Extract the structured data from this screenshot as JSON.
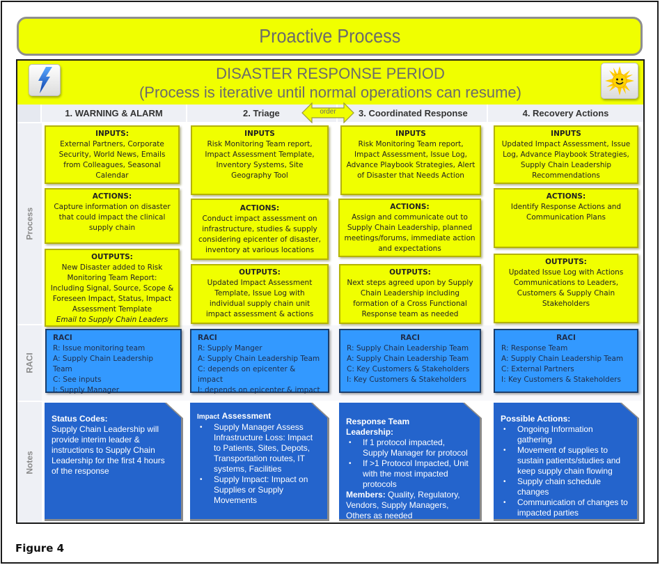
{
  "banner": {
    "title": "Proactive Process"
  },
  "diagram": {
    "title": "DISASTER RESPONSE PERIOD",
    "subtitle": "(Process is iterative until normal operations can resume)",
    "icons": {
      "left": "lightning-bolt-icon",
      "right": "smiling-sun-icon"
    },
    "order_arrow_label": "order",
    "row_labels": {
      "process": "Process",
      "raci": "RACI",
      "notes": "Notes"
    },
    "columns": [
      {
        "header": "1. WARNING & ALARM",
        "inputs": {
          "heading": "INPUTS:",
          "text": "External Partners, Corporate Security, World News, Emails from Colleagues, Seasonal Calendar"
        },
        "actions": {
          "heading": "ACTIONS:",
          "text": "Capture information on disaster that could impact the clinical supply chain"
        },
        "outputs": {
          "heading": "OUTPUTS:",
          "text": "New Disaster added to Risk Monitoring Team Report: Including Signal, Source, Scope & Foreseen Impact, Status, Impact Assessment Template",
          "italic": "Email to Supply Chain Leaders"
        },
        "raci": {
          "heading": "RACI",
          "r": "R: Issue monitoring team",
          "a": "A: Supply Chain Leadership Team",
          "c": "C: See inputs",
          "i": "I: Supply Manager"
        },
        "notes": {
          "heading": "Status Codes:",
          "text": "Supply Chain Leadership will provide interim leader & instructions to Supply Chain Leadership for the first 4 hours of the response"
        }
      },
      {
        "header": "2. Triage",
        "inputs": {
          "heading": "INPUTS",
          "text": "Risk Monitoring Team report, Impact Assessment Template, Inventory Systems, Site Geography Tool"
        },
        "actions": {
          "heading": "ACTIONS:",
          "text": "Conduct impact assessment on infrastructure, studies & supply considering epicenter of disaster, inventory at various locations"
        },
        "outputs": {
          "heading": "OUTPUTS:",
          "text": "Updated Impact Assessment Template, Issue Log with individual supply chain unit impact assessment & actions"
        },
        "raci": {
          "heading": "RACI",
          "r": "R: Supply Manger",
          "a": "A: Supply Chain Leadership Team",
          "c": "C: depends on epicenter & impact",
          "i": "I: depends on epicenter & impact"
        },
        "notes": {
          "heading_small": "Impact",
          "heading": "Assessment",
          "bullets": [
            "Supply Manager Assess Infrastructure Loss: Impact to Patients, Sites, Depots, Transportation routes, IT systems, Facilities",
            "Supply Impact: Impact on Supplies or Supply Movements"
          ]
        }
      },
      {
        "header": "3. Coordinated Response",
        "inputs": {
          "heading": "INPUTS",
          "text": "Risk Monitoring Team report, Impact Assessment, Issue Log, Advance Playbook Strategies, Alert of Disaster that Needs Action"
        },
        "actions": {
          "heading": "ACTIONS:",
          "text": "Assign and communicate out to Supply Chain Leadership, planned meetings/forums, immediate action and expectations"
        },
        "outputs": {
          "heading": "OUTPUTS:",
          "text": "Next steps agreed upon by Supply Chain Leadership including formation of a Cross Functional Response team as needed"
        },
        "raci": {
          "heading": "RACI",
          "r": "R: Supply Chain Leadership Team",
          "a": "A: Supply Chain Leadership Team",
          "c": "C: Key Customers & Stakeholders",
          "i": "I: Key Customers & Stakeholders"
        },
        "notes": {
          "heading": "Response Team Leadership:",
          "bullets": [
            "If 1 protocol impacted, Supply Manager for protocol",
            "If >1 Protocol Impacted,  Unit with the most impacted protocols"
          ],
          "members_label": "Members:",
          "members_text": "Quality, Regulatory, Vendors, Supply Managers, Others as needed"
        }
      },
      {
        "header": "4. Recovery Actions",
        "inputs": {
          "heading": "INPUTS",
          "text": "Updated Impact Assessment, Issue Log, Advance Playbook Strategies, Supply Chain Leadership Recommendations"
        },
        "actions": {
          "heading": "ACTIONS:",
          "text": "Identify Response Actions and Communication Plans"
        },
        "outputs": {
          "heading": "OUTPUTS:",
          "text": "Updated Issue Log with Actions Communications to Leaders, Customers & Supply Chain Stakeholders"
        },
        "raci": {
          "heading": "RACI",
          "r": "R: Response Team",
          "a": "A: Supply Chain Leadership Team",
          "c": "C: External Partners",
          "i": "I: Key Customers & Stakeholders"
        },
        "notes": {
          "heading": "Possible Actions:",
          "bullets": [
            "Ongoing Information gathering",
            "Movement of supplies to sustain patients/studies and keep supply chain flowing",
            "Supply chain schedule changes",
            "Communication of changes to impacted parties"
          ]
        }
      }
    ]
  },
  "caption": "Figure 4",
  "colors": {
    "yellow": "#f0ff00",
    "raci_blue": "#3399ff",
    "notes_blue": "#2464cc",
    "gray_text": "#6b6b6b"
  }
}
